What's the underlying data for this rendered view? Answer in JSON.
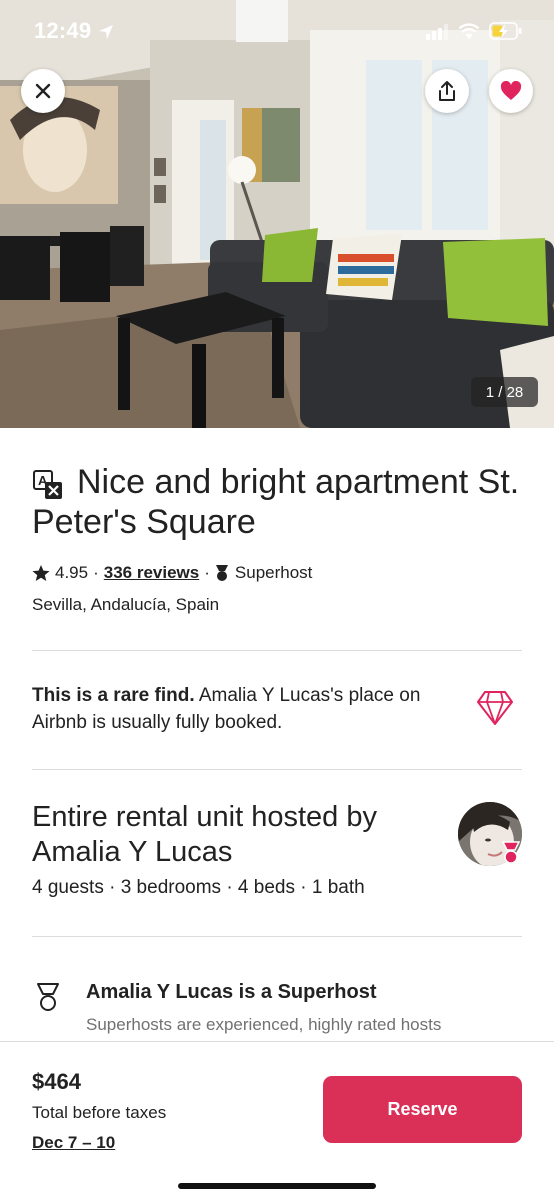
{
  "status_bar": {
    "time": "12:49"
  },
  "gallery": {
    "counter": "1 / 28"
  },
  "colors": {
    "brand": "#da3057",
    "heart": "#e0245e",
    "text": "#222222",
    "muted": "#717171"
  },
  "listing": {
    "title": "Nice and bright apartment St. Peter's Square",
    "rating": "4.95",
    "reviews": "336 reviews",
    "badge": "Superhost",
    "location": "Sevilla, Andalucía, Spain"
  },
  "rare_find": {
    "bold": "This is a rare find.",
    "text": " Amalia Y Lucas's place on Airbnb is usually fully booked."
  },
  "host": {
    "title": "Entire rental unit hosted by Amalia Y Lucas",
    "details": "4 guests · 3 bedrooms · 4 beds · 1 bath"
  },
  "superhost": {
    "title": "Amalia Y Lucas is a Superhost",
    "description": "Superhosts are experienced, highly rated hosts"
  },
  "footer": {
    "price": "$464",
    "price_note": "Total before taxes",
    "dates": "Dec 7 – 10",
    "reserve_label": "Reserve"
  },
  "icons": [
    "navigation-arrow-icon",
    "signal-icon",
    "wifi-icon",
    "battery-charging-icon",
    "close-icon",
    "share-icon",
    "heart-icon",
    "translate-icon",
    "star-icon",
    "superhost-icon",
    "diamond-icon"
  ]
}
